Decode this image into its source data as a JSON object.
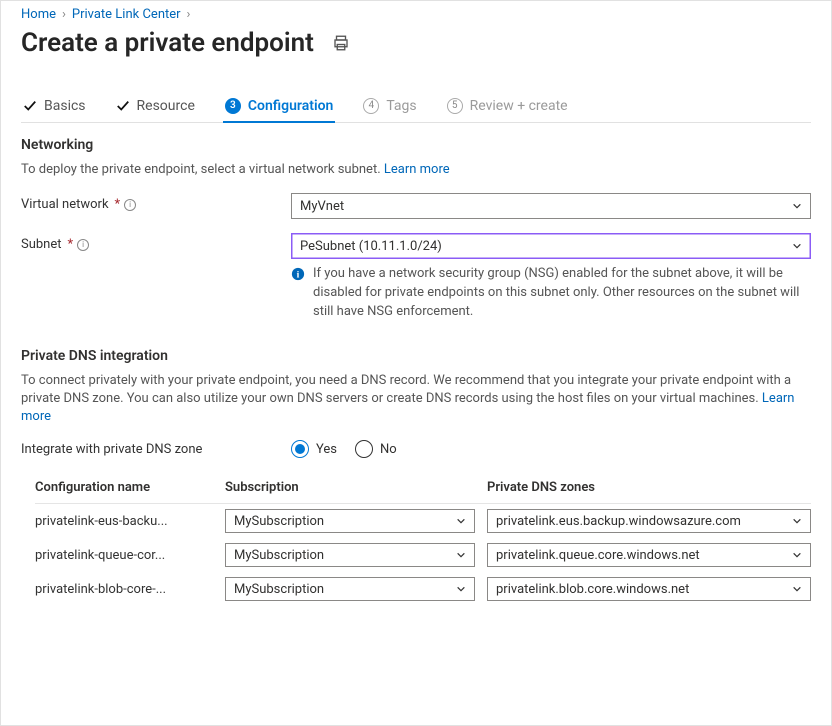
{
  "breadcrumb": {
    "home": "Home",
    "link_center": "Private Link Center"
  },
  "title": "Create a private endpoint",
  "tabs": {
    "basics": "Basics",
    "resource": "Resource",
    "configuration": {
      "num": "3",
      "label": "Configuration"
    },
    "tags": {
      "num": "4",
      "label": "Tags"
    },
    "review": {
      "num": "5",
      "label": "Review + create"
    }
  },
  "networking": {
    "heading": "Networking",
    "lead": "To deploy the private endpoint, select a virtual network subnet.  ",
    "learn_more": "Learn more",
    "vnet": {
      "label": "Virtual network",
      "value": "MyVnet"
    },
    "subnet": {
      "label": "Subnet",
      "value": "PeSubnet (10.11.1.0/24)"
    },
    "callout": "If you have a network security group (NSG) enabled for the subnet above, it will be disabled for private endpoints on this subnet only. Other resources on the subnet will still have NSG enforcement."
  },
  "dns": {
    "heading": "Private DNS integration",
    "lead": "To connect privately with your private endpoint, you need a DNS record. We recommend that you integrate your private endpoint with a private DNS zone. You can also utilize your own DNS servers or create DNS records using the host files on your virtual machines.  ",
    "learn_more": "Learn more",
    "integrate_label": "Integrate with private DNS zone",
    "yes": "Yes",
    "no": "No",
    "columns": {
      "name": "Configuration name",
      "sub": "Subscription",
      "zone": "Private DNS zones"
    },
    "rows": [
      {
        "name": "privatelink-eus-backu...",
        "sub": "MySubscription",
        "zone": "privatelink.eus.backup.windowsazure.com"
      },
      {
        "name": "privatelink-queue-cor...",
        "sub": "MySubscription",
        "zone": "privatelink.queue.core.windows.net"
      },
      {
        "name": "privatelink-blob-core-...",
        "sub": "MySubscription",
        "zone": "privatelink.blob.core.windows.net"
      }
    ]
  }
}
